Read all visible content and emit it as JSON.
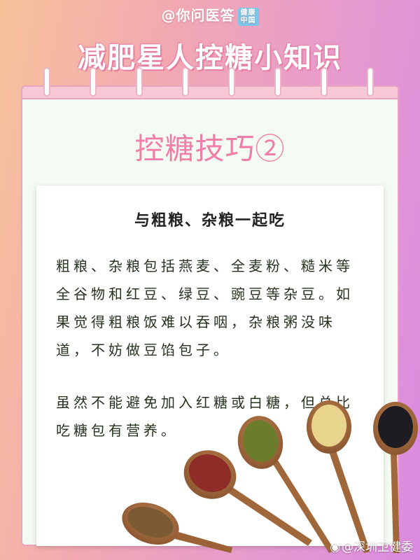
{
  "header": {
    "watermark": "@你问医答",
    "badge": "健康中国"
  },
  "banner": {
    "title": "减肥星人控糖小知识"
  },
  "notepad": {
    "subtitle": "控糖技巧②"
  },
  "card": {
    "heading": "与粗粮、杂粮一起吃",
    "paragraph_1": "粗粮、杂粮包括燕麦、全麦粉、糙米等全谷物和红豆、绿豆、豌豆等杂豆。如果觉得粗粮饭难以吞咽，杂粮粥没味道，不妨做豆馅包子。",
    "paragraph_2": "虽然不能避免加入红糖或白糖，但总比吃糖包有营养。"
  },
  "footer": {
    "credit": "@深圳卫健委"
  },
  "colors": {
    "banner_pink": "#e97fa3",
    "subtitle_pink": "#f07ea8",
    "notepad_bg": "#f4fbf2"
  }
}
